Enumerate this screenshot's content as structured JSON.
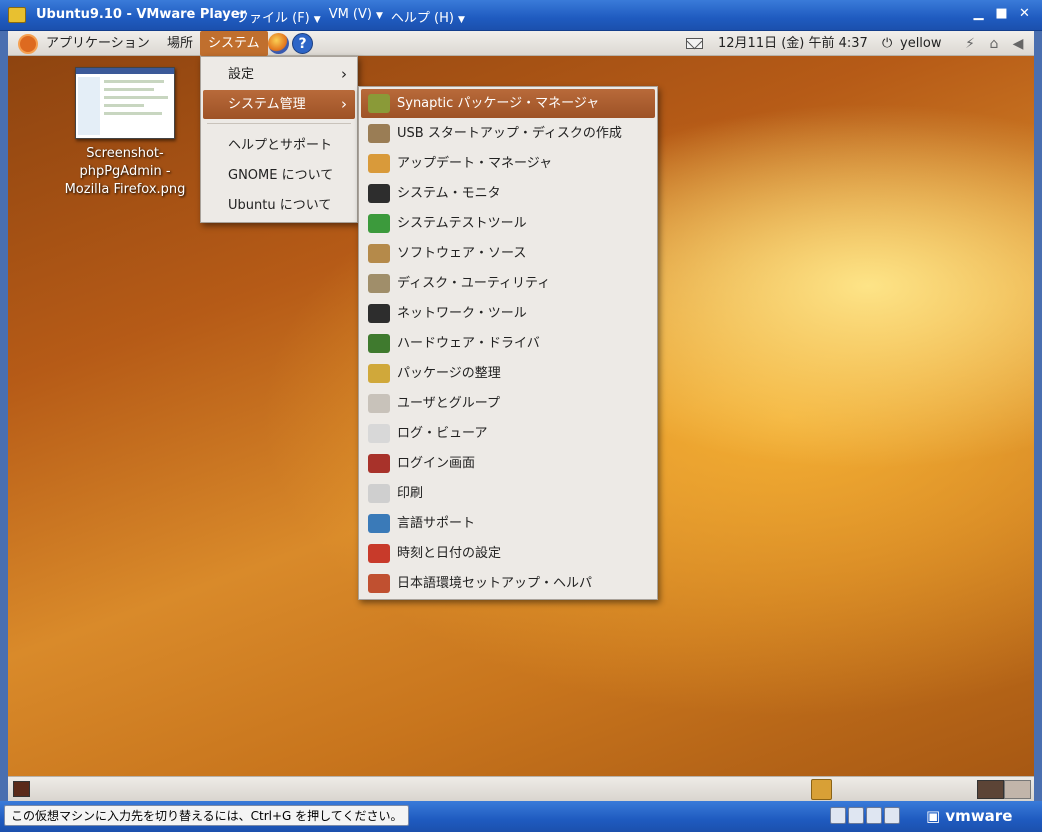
{
  "vm_window": {
    "title": "Ubuntu9.10 - VMware Player",
    "menu": [
      {
        "label": "ファイル (F)"
      },
      {
        "label": "VM (V)"
      },
      {
        "label": "ヘルプ (H)"
      }
    ],
    "status_text": "この仮想マシンに入力先を切り替えるには、Ctrl+G を押してください。",
    "brand": "vmware"
  },
  "top_panel": {
    "applications": "アプリケーション",
    "places": "場所",
    "system": "システム",
    "clock": "12月11日 (金) 午前 4:37",
    "user": "yellow",
    "icons": [
      "ubuntu-logo-icon",
      "firefox-icon",
      "help-icon",
      "mail-icon",
      "power-icon",
      "network-icon",
      "volume-icon"
    ]
  },
  "desktop": {
    "icon_label": [
      "Screenshot-",
      "phpPgAdmin -",
      "Mozilla Firefox.png"
    ]
  },
  "system_menu": {
    "items": [
      {
        "label": "設定"
      },
      {
        "label": "システム管理"
      },
      {
        "label": "ヘルプとサポート"
      },
      {
        "label": "GNOME について"
      },
      {
        "label": "Ubuntu について"
      }
    ]
  },
  "admin_menu": {
    "items": [
      {
        "label": "Synaptic パッケージ・マネージャ",
        "icon": "package-icon",
        "color": "#8a9a38"
      },
      {
        "label": "USB スタートアップ・ディスクの作成",
        "icon": "usb-disk-icon",
        "color": "#9a7d55"
      },
      {
        "label": "アップデート・マネージャ",
        "icon": "update-icon",
        "color": "#d99a3a"
      },
      {
        "label": "システム・モニタ",
        "icon": "monitor-icon",
        "color": "#2d2d2d"
      },
      {
        "label": "システムテストツール",
        "icon": "checklist-icon",
        "color": "#3c9a3c"
      },
      {
        "label": "ソフトウェア・ソース",
        "icon": "software-sources-icon",
        "color": "#b58a4a"
      },
      {
        "label": "ディスク・ユーティリティ",
        "icon": "disk-icon",
        "color": "#a08e6a"
      },
      {
        "label": "ネットワーク・ツール",
        "icon": "network-tools-icon",
        "color": "#2d2d2d"
      },
      {
        "label": "ハードウェア・ドライバ",
        "icon": "hardware-icon",
        "color": "#3f7a2e"
      },
      {
        "label": "パッケージの整理",
        "icon": "broom-icon",
        "color": "#d0a83a"
      },
      {
        "label": "ユーザとグループ",
        "icon": "users-icon",
        "color": "#c8c2ba"
      },
      {
        "label": "ログ・ビューア",
        "icon": "log-viewer-icon",
        "color": "#d8d8d8"
      },
      {
        "label": "ログイン画面",
        "icon": "login-screen-icon",
        "color": "#a8322a"
      },
      {
        "label": "印刷",
        "icon": "printer-icon",
        "color": "#cfcfcf"
      },
      {
        "label": "言語サポート",
        "icon": "language-icon",
        "color": "#3a7ab8"
      },
      {
        "label": "時刻と日付の設定",
        "icon": "time-date-icon",
        "color": "#c83a2a"
      },
      {
        "label": "日本語環境セットアップ・ヘルパ",
        "icon": "japanese-setup-icon",
        "color": "#c05030"
      }
    ]
  }
}
